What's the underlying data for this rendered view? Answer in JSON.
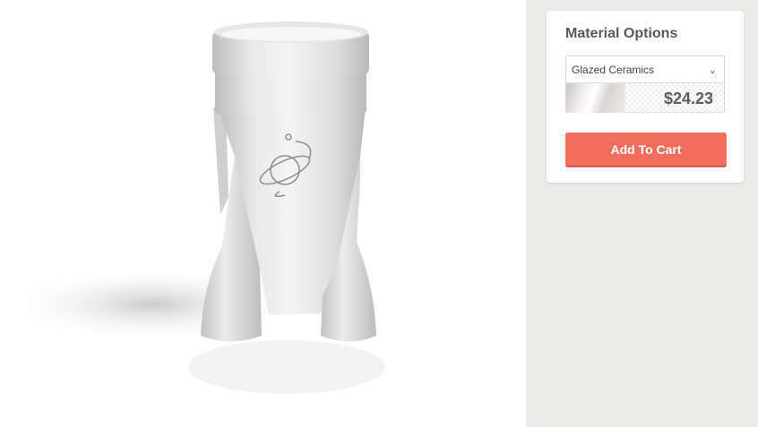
{
  "material": {
    "title": "Material Options",
    "selected": "Glazed Ceramics",
    "price": "$24.23",
    "add_to_cart": "Add To Cart"
  },
  "icons": {
    "dropdown": "chevron-down-icon",
    "logo": "planet-orbit-logo"
  },
  "colors": {
    "accent": "#f26d5b",
    "sidebar_bg": "#ebebe9"
  }
}
